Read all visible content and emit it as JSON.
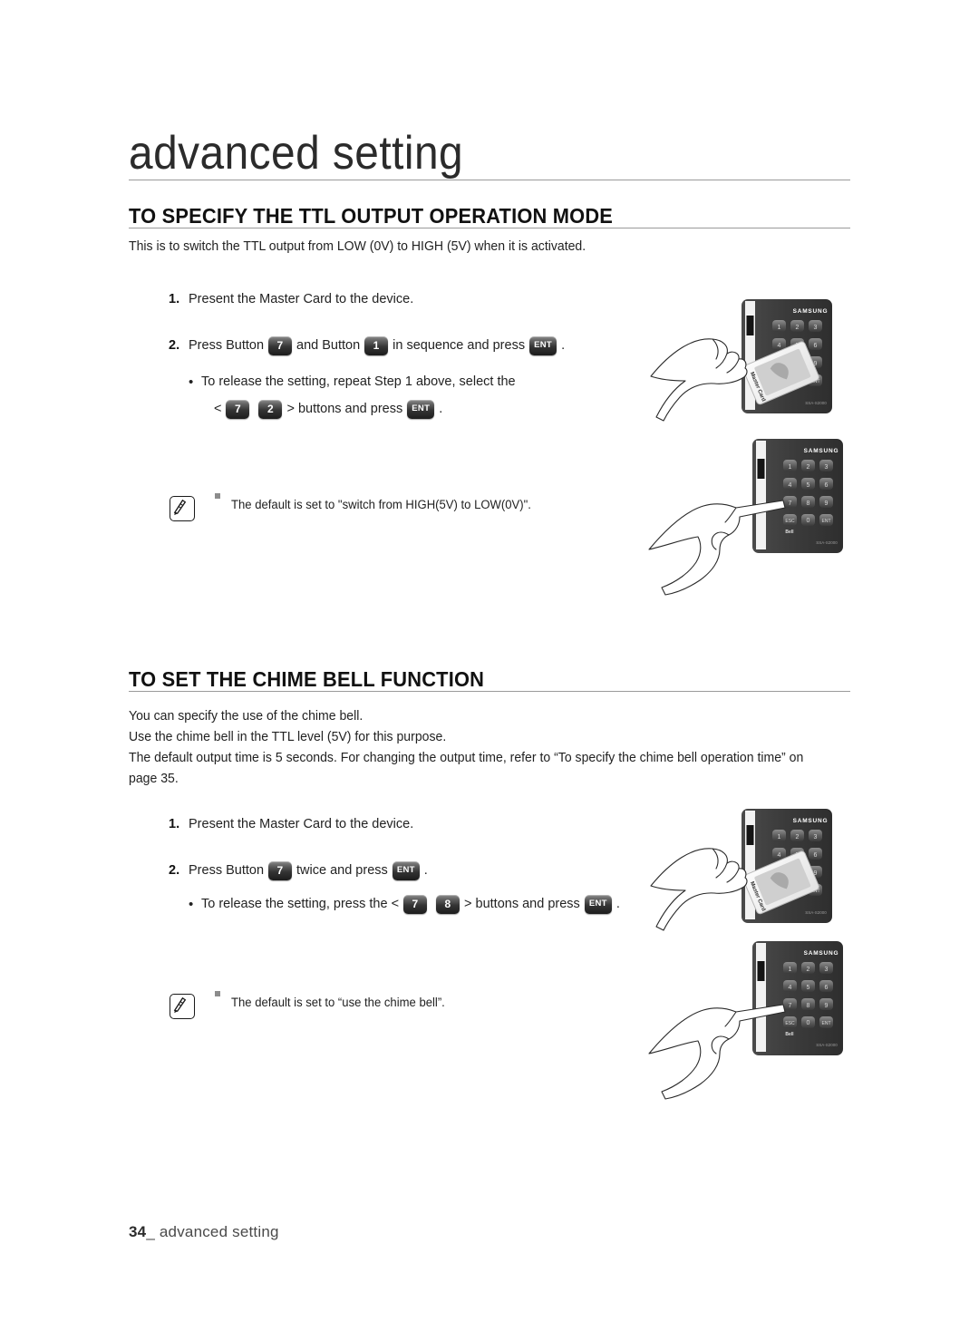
{
  "page": {
    "chapter_title": "advanced setting",
    "footer_page_number": "34",
    "footer_label": "advanced setting"
  },
  "sections": [
    {
      "heading": "TO SPECIFY THE TTL OUTPUT OPERATION MODE",
      "intro": "This is to switch the TTL output from LOW (0V) to HIGH (5V) when it is activated.",
      "steps": [
        {
          "num": "1.",
          "text": "Present the Master Card to the device."
        },
        {
          "num": "2.",
          "pre": "Press Button",
          "key1": "7",
          "mid": "and Button",
          "key2": "1",
          "post": "in sequence and press",
          "key3": "ENT",
          "end": "."
        }
      ],
      "bullets": [
        {
          "line1": "To release the setting, repeat Step 1 above, select the",
          "line2_pre": "<",
          "key1": "7",
          "key2": "2",
          "line2_mid": "> buttons and press",
          "key3": "ENT",
          "line2_end": "."
        }
      ],
      "note": "The default is set to \"switch from HIGH(5V) to LOW(0V)\"."
    },
    {
      "heading": "TO SET THE CHIME BELL FUNCTION",
      "intro_lines": [
        "You can specify the use of the chime bell.",
        "Use the chime bell in the TTL level (5V) for this purpose.",
        "The default output time is 5 seconds. For changing the output time, refer to “To specify the chime bell operation time” on",
        "page 35."
      ],
      "steps": [
        {
          "num": "1.",
          "text": "Present the Master Card to the device."
        },
        {
          "num": "2.",
          "pre": "Press Button",
          "key1": "7",
          "post": "twice and press",
          "key3": "ENT",
          "end": "."
        }
      ],
      "bullets": [
        {
          "line1_pre": "To release the setting, press the <",
          "key1": "7",
          "key2": "8",
          "line1_mid": "> buttons and press",
          "key3": "ENT",
          "line1_end": "."
        }
      ],
      "note": "The default is set to “use the chime bell”."
    }
  ],
  "illustrations": {
    "device_brand": "SAMSUNG",
    "device_model": "SSA-S2000",
    "bell_label": "Bell",
    "card_label": "Master Card",
    "keys": [
      "1",
      "2",
      "3",
      "4",
      "5",
      "6",
      "7",
      "8",
      "9",
      "ESC",
      "0",
      "ENT"
    ],
    "items": [
      {
        "name": "present-master-card",
        "caption": "Hand presenting Master Card to keypad device"
      },
      {
        "name": "press-button-seven",
        "caption": "Finger pressing button 7 on keypad device"
      },
      {
        "name": "present-master-card",
        "caption": "Hand presenting Master Card to keypad device"
      },
      {
        "name": "press-button-seven",
        "caption": "Finger pressing button 7 on keypad device"
      }
    ]
  },
  "colors": {
    "rule": "#9a9a9a",
    "text": "#222222",
    "key_dark": "#1c1c1c",
    "device_body": "#3c3c3c"
  }
}
